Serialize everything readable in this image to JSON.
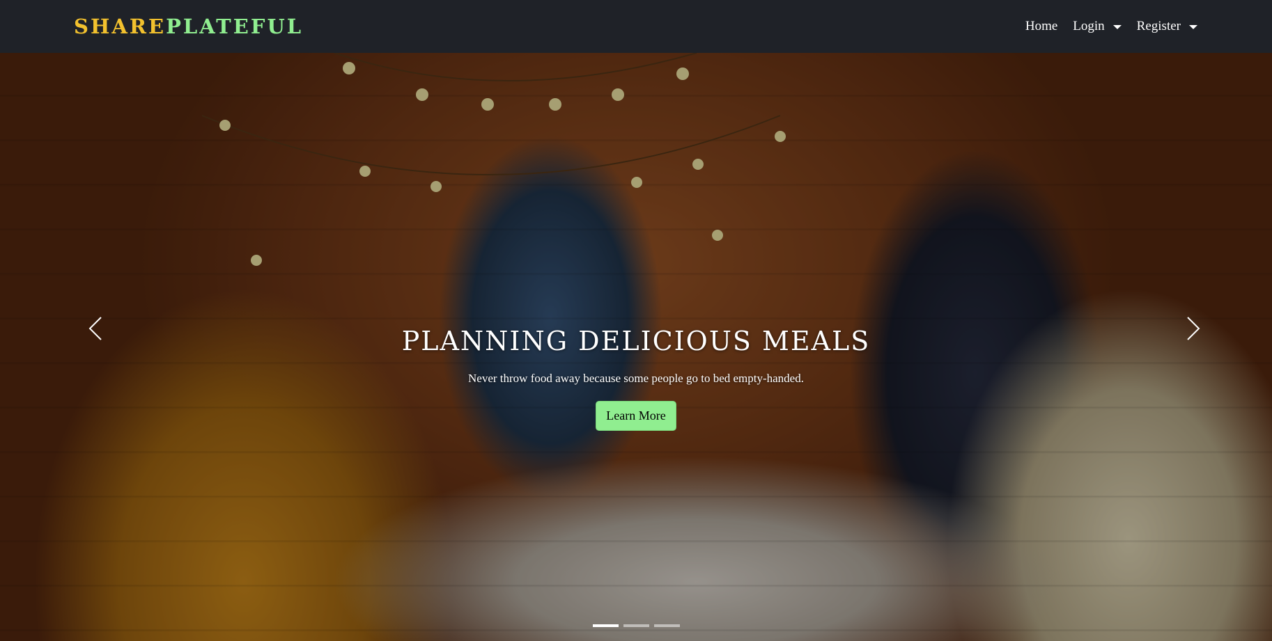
{
  "brand": {
    "part1": "SHARE",
    "part2": "PLATEFUL",
    "color1": "#f2c12e",
    "color2": "#90ee90"
  },
  "nav": {
    "home": "Home",
    "login": "Login",
    "register": "Register"
  },
  "carousel": {
    "title": "PLANNING DELICIOUS MEALS",
    "subtitle": "Never throw food away because some people go to bed empty-handed.",
    "button": "Learn More",
    "button_color": "#90ee90",
    "slide_count": 3,
    "active_slide": 1,
    "prev_icon": "chevron-left-icon",
    "next_icon": "chevron-right-icon"
  }
}
